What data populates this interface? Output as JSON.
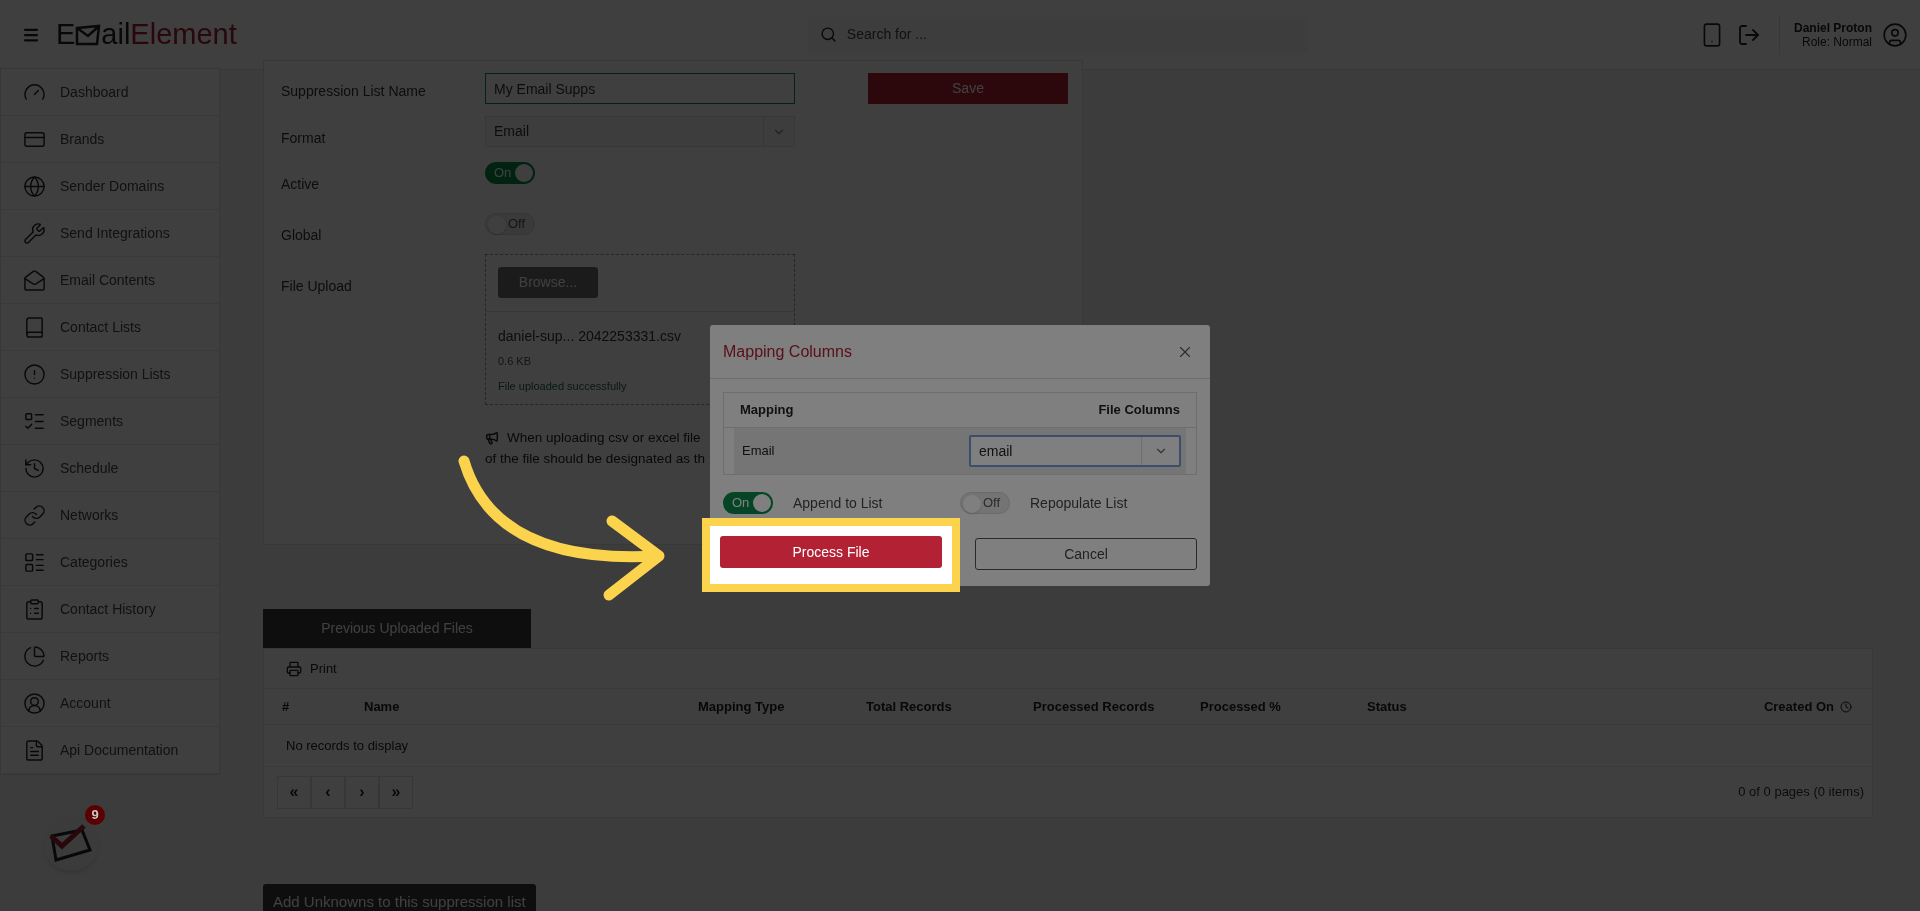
{
  "header": {
    "logo": {
      "prefix": "E",
      "middle": "ail",
      "suffix": "Element"
    },
    "search": {
      "placeholder": "Search for ..."
    },
    "user": {
      "name": "Daniel Proton",
      "role": "Role: Normal"
    }
  },
  "sidebar": {
    "items": [
      {
        "label": "Dashboard"
      },
      {
        "label": "Brands"
      },
      {
        "label": "Sender Domains"
      },
      {
        "label": "Send Integrations"
      },
      {
        "label": "Email Contents"
      },
      {
        "label": "Contact Lists"
      },
      {
        "label": "Suppression Lists"
      },
      {
        "label": "Segments"
      },
      {
        "label": "Schedule"
      },
      {
        "label": "Networks"
      },
      {
        "label": "Categories"
      },
      {
        "label": "Contact History"
      },
      {
        "label": "Reports"
      },
      {
        "label": "Account"
      },
      {
        "label": "Api Documentation"
      }
    ],
    "notification_count": "9"
  },
  "form": {
    "name": {
      "label": "Suppression List Name",
      "value": "My Email Supps"
    },
    "format": {
      "label": "Format",
      "value": "Email"
    },
    "active": {
      "label": "Active",
      "on": true,
      "text": "On"
    },
    "global": {
      "label": "Global",
      "on": false,
      "text": "Off"
    },
    "file_upload": {
      "label": "File Upload",
      "browse": "Browse...",
      "file_name": "daniel-sup... 2042253331.csv",
      "file_size": "0.6 KB",
      "status": "File uploaded successfully"
    },
    "note": [
      "When uploading csv or excel file",
      "of the file should be designated as th"
    ],
    "save": "Save"
  },
  "modal": {
    "title": "Mapping Columns",
    "columns": [
      "Mapping",
      "File Columns"
    ],
    "rows": [
      {
        "mapping": "Email",
        "file_column": "email"
      }
    ],
    "toggles": [
      {
        "label": "Append to List",
        "on": true,
        "text": "On"
      },
      {
        "label": "Repopulate List",
        "on": false,
        "text": "Off"
      }
    ],
    "process": "Process File",
    "cancel": "Cancel"
  },
  "uploads": {
    "tab": "Previous Uploaded Files",
    "print": "Print",
    "columns": [
      "#",
      "Name",
      "Mapping Type",
      "Total Records",
      "Processed Records",
      "Processed %",
      "Status",
      "Created On"
    ],
    "empty": "No records to display",
    "pager": [
      "«",
      "‹",
      "›",
      "»"
    ],
    "page_info": "0 of 0 pages (0 items)"
  },
  "add_unknowns": "Add Unknowns to this suppression list"
}
